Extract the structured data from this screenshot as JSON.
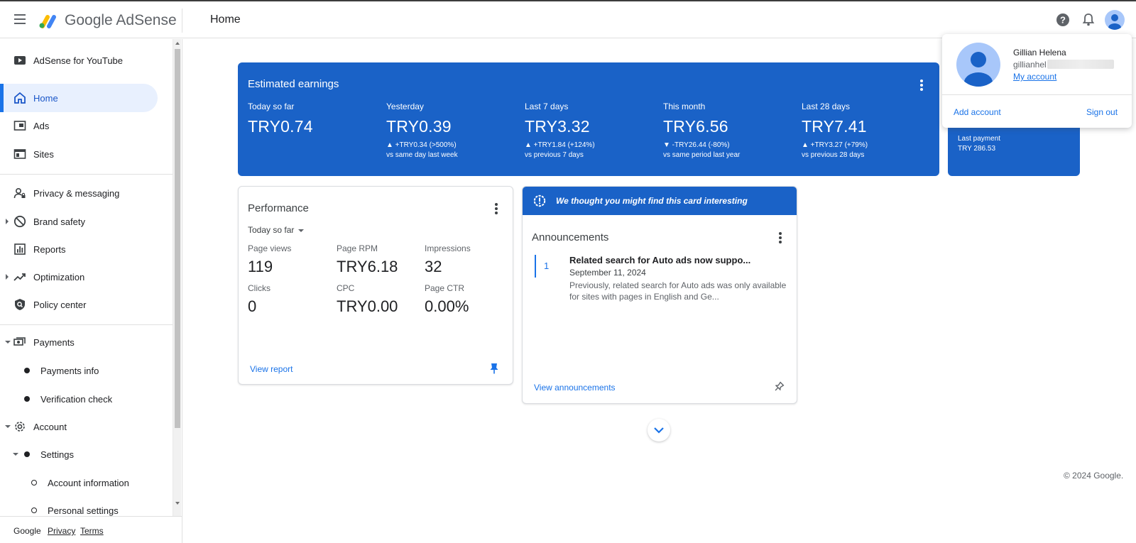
{
  "app": {
    "name": "Google AdSense"
  },
  "header": {
    "title": "Home"
  },
  "colors": {
    "brand_blue": "#1a62c7",
    "link_blue": "#1a73e8",
    "active_bg": "#e8f0fe"
  },
  "sidebar": {
    "items": [
      {
        "label": "AdSense for YouTube",
        "icon": "youtube-icon"
      },
      {
        "label": "Home",
        "icon": "home-icon",
        "active": true
      },
      {
        "label": "Ads",
        "icon": "ads-icon"
      },
      {
        "label": "Sites",
        "icon": "sites-icon"
      },
      {
        "label": "Privacy & messaging",
        "icon": "privacy-icon"
      },
      {
        "label": "Brand safety",
        "icon": "block-icon"
      },
      {
        "label": "Reports",
        "icon": "bar-chart-icon"
      },
      {
        "label": "Optimization",
        "icon": "trending-up-icon"
      },
      {
        "label": "Policy center",
        "icon": "policy-shield-icon"
      },
      {
        "label": "Payments",
        "icon": "payments-icon"
      },
      {
        "label": "Payments info"
      },
      {
        "label": "Verification check"
      },
      {
        "label": "Account",
        "icon": "gear-icon"
      },
      {
        "label": "Settings"
      },
      {
        "label": "Account information"
      },
      {
        "label": "Personal settings"
      }
    ]
  },
  "footer": {
    "brand": "Google",
    "privacy": "Privacy",
    "terms": "Terms"
  },
  "earnings": {
    "title": "Estimated earnings",
    "columns": [
      {
        "label": "Today so far",
        "value": "TRY0.74",
        "delta": "",
        "compare": ""
      },
      {
        "label": "Yesterday",
        "value": "TRY0.39",
        "delta": "▲ +TRY0.34 (>500%)",
        "compare": "vs same day last week"
      },
      {
        "label": "Last 7 days",
        "value": "TRY3.32",
        "delta": "▲ +TRY1.84 (+124%)",
        "compare": "vs previous 7 days"
      },
      {
        "label": "This month",
        "value": "TRY6.56",
        "delta": "▼ -TRY26.44 (-80%)",
        "compare": "vs same period last year"
      },
      {
        "label": "Last 28 days",
        "value": "TRY7.41",
        "delta": "▲ +TRY3.27 (+79%)",
        "compare": "vs previous 28 days"
      }
    ]
  },
  "payment_card": {
    "label": "Last payment",
    "value": "TRY 286.53"
  },
  "performance": {
    "title": "Performance",
    "range": "Today so far",
    "metrics": [
      {
        "label": "Page views",
        "value": "119"
      },
      {
        "label": "Page RPM",
        "value": "TRY6.18"
      },
      {
        "label": "Impressions",
        "value": "32"
      },
      {
        "label": "Clicks",
        "value": "0"
      },
      {
        "label": "CPC",
        "value": "TRY0.00"
      },
      {
        "label": "Page CTR",
        "value": "0.00%"
      }
    ],
    "link": "View report"
  },
  "announcements": {
    "banner": "We thought you might find this card interesting",
    "title": "Announcements",
    "item": {
      "number": "1",
      "headline": "Related search for Auto ads now suppo...",
      "date": "September 11, 2024",
      "body": "Previously, related search for Auto ads was only available for sites with pages in English and Ge..."
    },
    "link": "View announcements"
  },
  "copyright": "© 2024 Google.",
  "account_popup": {
    "name": "Gillian Helena",
    "email_visible": "gillianhel",
    "my_account": "My account",
    "add_account": "Add account",
    "sign_out": "Sign out"
  }
}
